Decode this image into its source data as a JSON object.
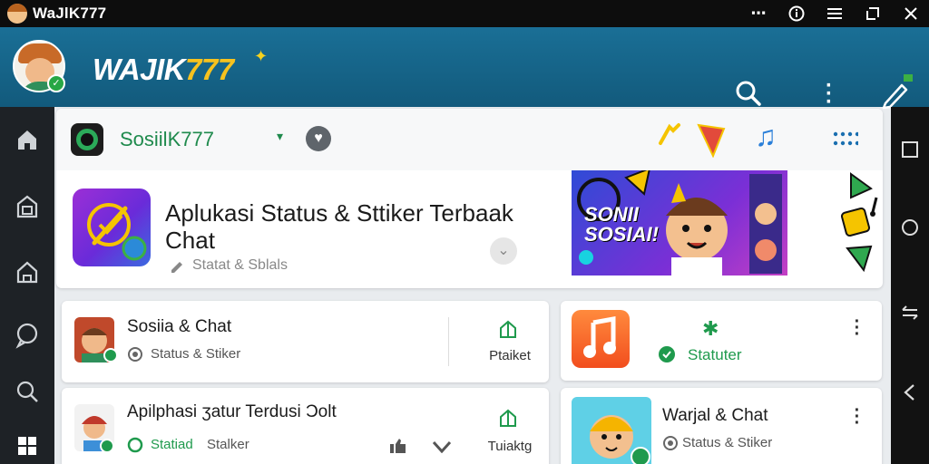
{
  "window": {
    "title": "WaJlK777",
    "controls": [
      "more",
      "info",
      "menu",
      "restore",
      "close"
    ]
  },
  "header": {
    "brand_prefix": "WAJIK",
    "brand_suffix": "777",
    "colors": {
      "bg": "#1a6f96",
      "brand_accent": "#f7c21e"
    }
  },
  "left_nav": [
    "home-icon",
    "store-icon",
    "home-outline-icon",
    "chat-icon",
    "search-icon",
    "windows-icon"
  ],
  "right_nav": [
    "square-icon",
    "circle-icon",
    "switch-icon",
    "back-icon"
  ],
  "top_card": {
    "channel_name": "SosiilK777",
    "channel_caret": "▾",
    "app_title": "Aplukasi Status & Sttiker Terbaak Chat",
    "app_subtitle": "Statat & Sblals",
    "banner_text_line1": "SONII",
    "banner_text_line2": "SOSIAI!"
  },
  "cards": [
    {
      "title": "Sosiia & Chat",
      "subtitle": "Status & Stiker",
      "action_label": "Ptaiket"
    },
    {
      "title": "Apilphasi ʒatur Terdusi Ɔolt",
      "subtitle": "Statiad",
      "subtitle2": "Stalker",
      "action_label": "Tuiaktg"
    },
    {
      "title": "",
      "subtitle": "Statuter"
    },
    {
      "title": "Warjal & Chat",
      "subtitle": "Status & Stiker"
    }
  ]
}
